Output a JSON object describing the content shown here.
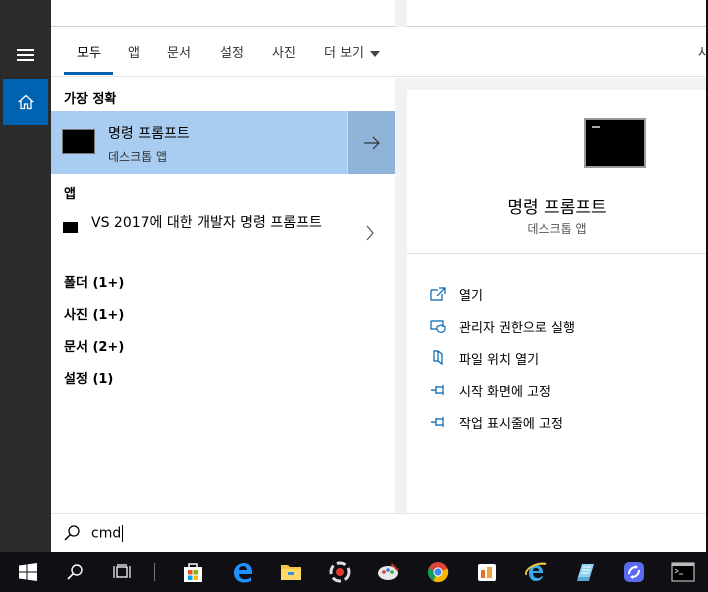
{
  "tabs": [
    {
      "label": "모두"
    },
    {
      "label": "앱"
    },
    {
      "label": "문서"
    },
    {
      "label": "설정"
    },
    {
      "label": "사진"
    },
    {
      "label": "더 보기"
    }
  ],
  "tabs_overflow": "사",
  "sections": {
    "best_match": "가장 정확",
    "apps": "앱"
  },
  "best_match": {
    "title": "명령 프롬프트",
    "subtitle": "데스크톱 앱"
  },
  "app_result": {
    "title": "VS 2017에 대한 개발자 명령 프롬프트"
  },
  "categories": [
    {
      "label": "폴더 (1+)"
    },
    {
      "label": "사진 (1+)"
    },
    {
      "label": "문서 (2+)"
    },
    {
      "label": "설정 (1)"
    }
  ],
  "preview": {
    "title": "명령 프롬프트",
    "subtitle": "데스크톱 앱",
    "actions": [
      {
        "label": "열기",
        "icon": "open-icon"
      },
      {
        "label": "관리자 권한으로 실행",
        "icon": "shield-icon"
      },
      {
        "label": "파일 위치 열기",
        "icon": "file-location-icon"
      },
      {
        "label": "시작 화면에 고정",
        "icon": "pin-icon"
      },
      {
        "label": "작업 표시줄에 고정",
        "icon": "pin-icon"
      }
    ]
  },
  "search": {
    "value": "cmd"
  },
  "colors": {
    "accent": "#0063b1",
    "best_match_bg": "#a8cdf0",
    "rail_bg": "#2b2b2b",
    "taskbar_bg": "#0f0f14"
  },
  "taskbar": [
    {
      "name": "windows-start-icon"
    },
    {
      "name": "search-icon"
    },
    {
      "name": "task-view-icon"
    },
    {
      "name": "store-icon"
    },
    {
      "name": "edge-icon"
    },
    {
      "name": "file-explorer-icon"
    },
    {
      "name": "app-icon"
    },
    {
      "name": "paint-icon"
    },
    {
      "name": "chrome-icon"
    },
    {
      "name": "app-icon"
    },
    {
      "name": "internet-explorer-icon"
    },
    {
      "name": "app-icon"
    },
    {
      "name": "app-icon"
    },
    {
      "name": "command-prompt-icon"
    }
  ]
}
